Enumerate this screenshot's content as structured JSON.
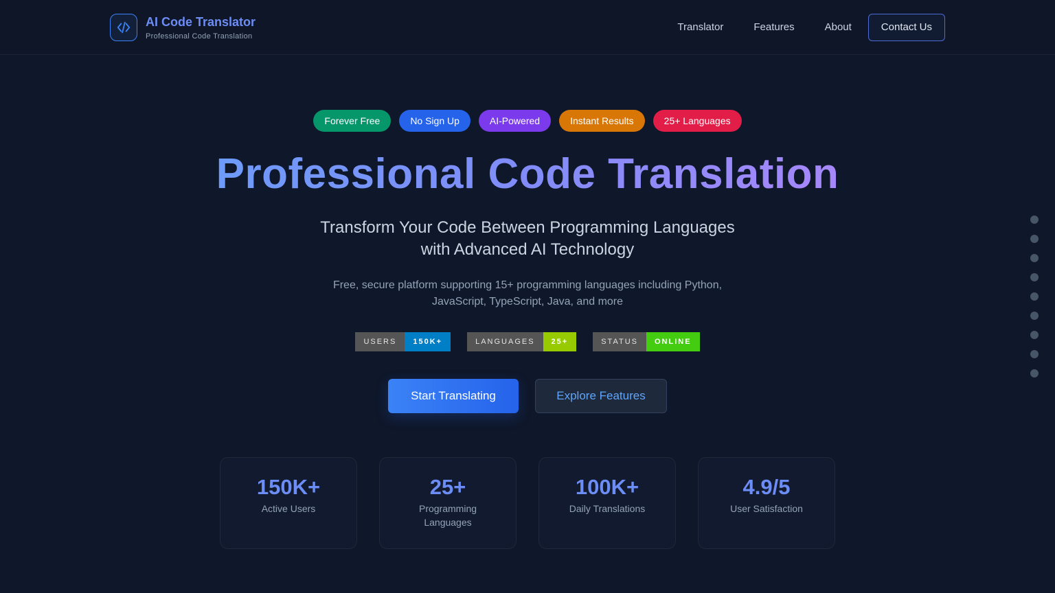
{
  "nav": {
    "brand_title": "AI Code Translator",
    "brand_subtitle": "Professional Code Translation",
    "logo_icon": "code-brackets-icon",
    "links": [
      "Translator",
      "Features",
      "About"
    ],
    "contact_label": "Contact Us"
  },
  "pills": [
    {
      "label": "Forever Free",
      "color": "#059669"
    },
    {
      "label": "No Sign Up",
      "color": "#2563eb"
    },
    {
      "label": "AI-Powered",
      "color": "#7c3aed"
    },
    {
      "label": "Instant Results",
      "color": "#d97706"
    },
    {
      "label": "25+ Languages",
      "color": "#e11d48"
    }
  ],
  "hero": {
    "title": "Professional Code Translation",
    "subtitle_line1": "Transform Your Code Between Programming Languages",
    "subtitle_line2": "with Advanced AI Technology",
    "description": "Free, secure platform supporting 15+ programming languages including Python, JavaScript, TypeScript, Java, and more"
  },
  "badges": [
    {
      "key": "USERS",
      "value": "150K+",
      "color": "#007ec6"
    },
    {
      "key": "LANGUAGES",
      "value": "25+",
      "color": "#97ca00"
    },
    {
      "key": "STATUS",
      "value": "ONLINE",
      "color": "#4c1"
    }
  ],
  "cta": {
    "primary": "Start Translating",
    "secondary": "Explore Features"
  },
  "stats": [
    {
      "value": "150K+",
      "label": "Active Users"
    },
    {
      "value": "25+",
      "label": "Programming Languages"
    },
    {
      "value": "100K+",
      "label": "Daily Translations"
    },
    {
      "value": "4.9/5",
      "label": "User Satisfaction"
    }
  ],
  "side_dots_count": 9
}
